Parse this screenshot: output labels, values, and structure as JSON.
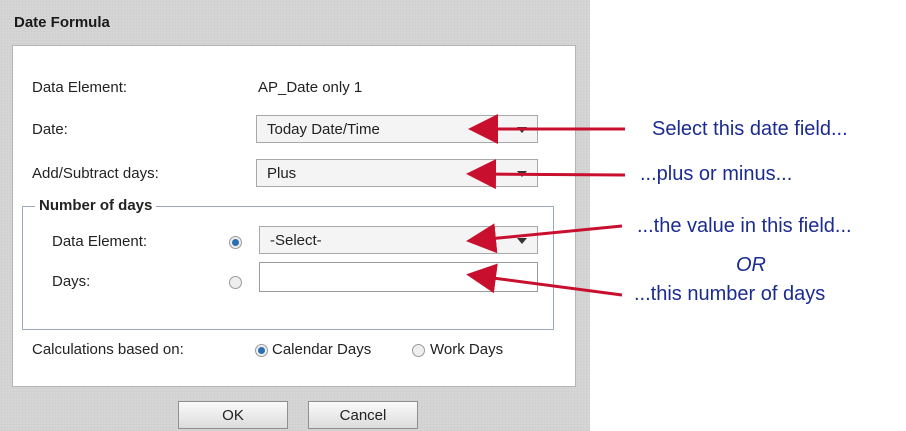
{
  "dialog": {
    "title": "Date Formula",
    "data_element_label": "Data Element:",
    "data_element_value": "AP_Date only 1",
    "date_label": "Date:",
    "date_value": "Today Date/Time",
    "add_sub_label": "Add/Subtract days:",
    "add_sub_value": "Plus",
    "number_of_days_legend": "Number of days",
    "nod_data_element_label": "Data Element:",
    "nod_data_element_value": "-Select-",
    "days_label": "Days:",
    "days_value": "",
    "calc_label": "Calculations based on:",
    "calc_calendar": "Calendar Days",
    "calc_work": "Work Days",
    "ok": "OK",
    "cancel": "Cancel"
  },
  "annotations": {
    "a1": "Select this date field...",
    "a2": "...plus or minus...",
    "a3": "...the value in this field...",
    "or": "OR",
    "a4": "...this number of days"
  },
  "colors": {
    "annotation": "#1b2b8f",
    "arrow": "#c8102e"
  }
}
